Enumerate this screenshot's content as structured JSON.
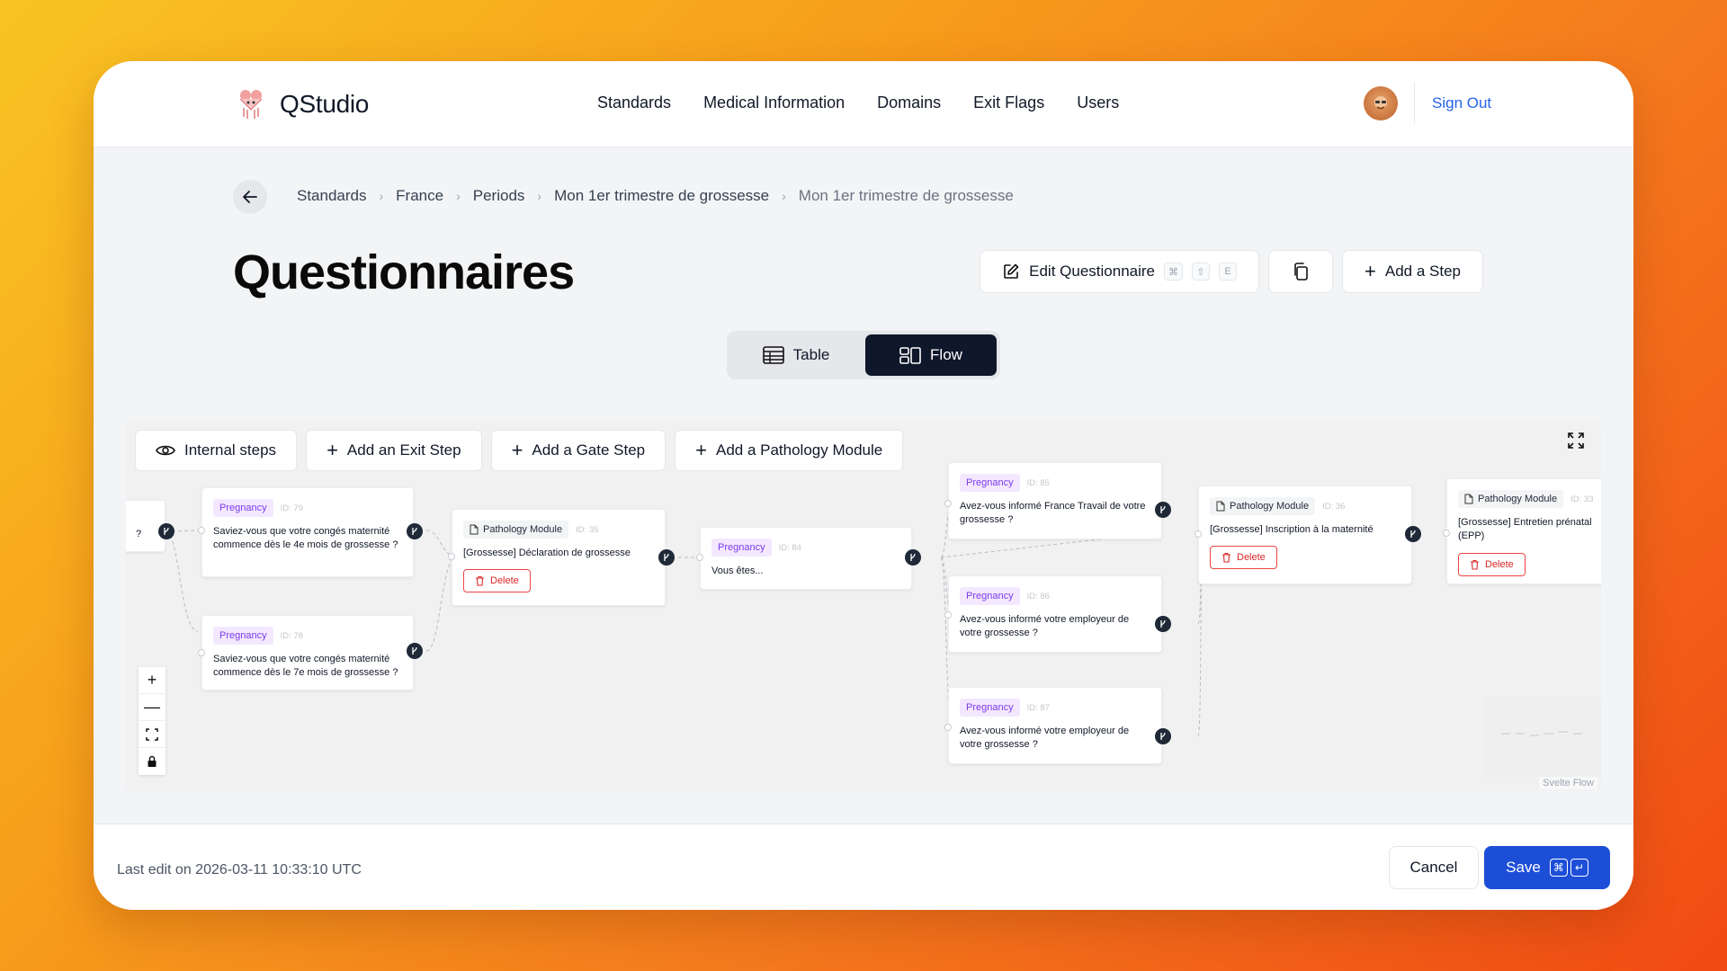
{
  "app": {
    "name": "QStudio"
  },
  "nav": [
    "Standards",
    "Medical Information",
    "Domains",
    "Exit Flags",
    "Users"
  ],
  "user": {
    "sign_out": "Sign Out"
  },
  "breadcrumb": [
    "Standards",
    "France",
    "Periods",
    "Mon 1er trimestre de grossesse",
    "Mon 1er trimestre de grossesse"
  ],
  "page": {
    "title": "Questionnaires"
  },
  "actions": {
    "edit": "Edit Questionnaire",
    "edit_keys": [
      "⌘",
      "⇧",
      "E"
    ],
    "add_step": "Add a Step"
  },
  "view_toggle": {
    "table": "Table",
    "flow": "Flow",
    "active": "Flow"
  },
  "flow_toolbar": {
    "internal_steps": "Internal steps",
    "add_exit": "Add an Exit Step",
    "add_gate": "Add a Gate Step",
    "add_pathology": "Add a Pathology Module"
  },
  "nodes": [
    {
      "type": "Pregnancy",
      "id": "ID: 79",
      "text": "Saviez-vous que votre congés maternité commence dès le 4e mois de grossesse ?"
    },
    {
      "type": "Pregnancy",
      "id": "ID: 78",
      "text": "Saviez-vous que votre congés maternité commence dès le 7e mois de grossesse ?"
    },
    {
      "type": "Pathology Module",
      "id": "ID: 35",
      "text": "[Grossesse] Déclaration de grossesse",
      "delete": "Delete"
    },
    {
      "type": "Pregnancy",
      "id": "ID: 84",
      "text": "Vous êtes..."
    },
    {
      "type": "Pregnancy",
      "id": "ID: 85",
      "text": "Avez-vous informé France Travail de votre grossesse ?"
    },
    {
      "type": "Pregnancy",
      "id": "ID: 86",
      "text": "Avez-vous informé votre employeur de votre grossesse ?"
    },
    {
      "type": "Pregnancy",
      "id": "ID: 87",
      "text": "Avez-vous informé votre employeur de votre grossesse ?"
    },
    {
      "type": "Pathology Module",
      "id": "ID: 36",
      "text": "[Grossesse] Inscription à la maternité",
      "delete": "Delete"
    },
    {
      "type": "Pathology Module",
      "id": "ID: 33",
      "text": "[Grossesse] Entretien prénatal (EPP)",
      "delete": "Delete"
    }
  ],
  "partial_node_text": "?",
  "flow_attribution": "Svelte Flow",
  "footer": {
    "last_edit": "Last edit on 2026-03-11 10:33:10 UTC",
    "cancel": "Cancel",
    "save": "Save",
    "save_keys": [
      "⌘",
      "↵"
    ]
  }
}
